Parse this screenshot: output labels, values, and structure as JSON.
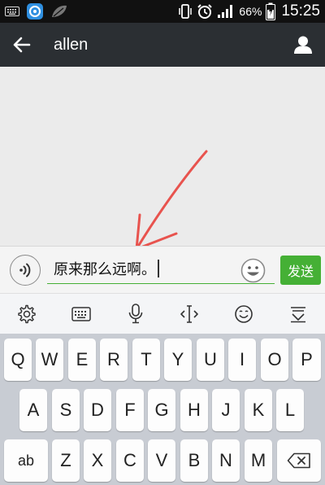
{
  "status_bar": {
    "battery_percent": "66%",
    "time": "15:25"
  },
  "header": {
    "title": "allen"
  },
  "input_bar": {
    "message_text": "原来那么远啊。",
    "send_label": "发送"
  },
  "keyboard": {
    "row1": [
      "Q",
      "W",
      "E",
      "R",
      "T",
      "Y",
      "U",
      "I",
      "O",
      "P"
    ],
    "row2": [
      "A",
      "S",
      "D",
      "F",
      "G",
      "H",
      "J",
      "K",
      "L"
    ],
    "row3": [
      "ab",
      "Z",
      "X",
      "C",
      "V",
      "B",
      "N",
      "M"
    ]
  },
  "colors": {
    "accent": "#45b035",
    "header_bg": "#2b2f33",
    "annotation_arrow": "#e8534e"
  }
}
